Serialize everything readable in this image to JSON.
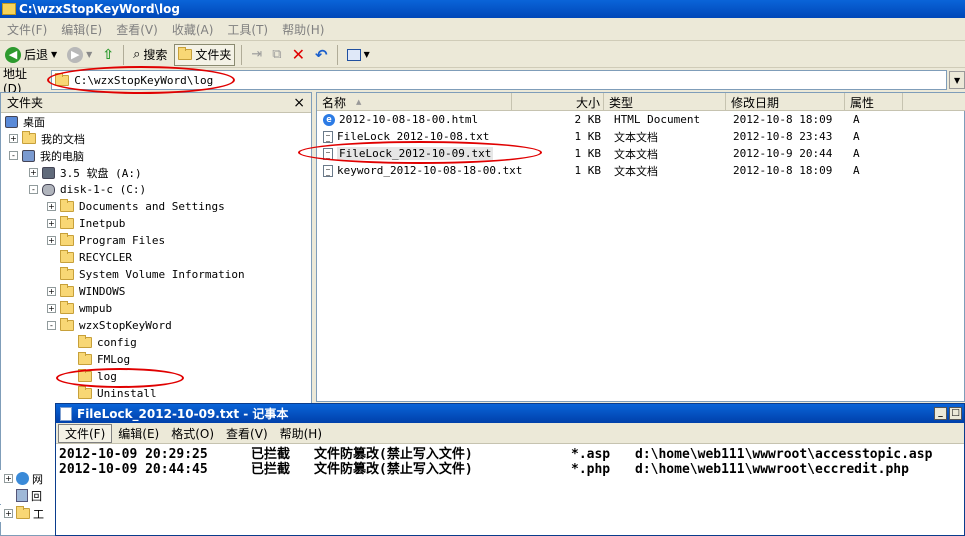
{
  "window": {
    "title": "C:\\wzxStopKeyWord\\log"
  },
  "menubar": [
    {
      "label": "文件(F)"
    },
    {
      "label": "编辑(E)"
    },
    {
      "label": "查看(V)"
    },
    {
      "label": "收藏(A)"
    },
    {
      "label": "工具(T)"
    },
    {
      "label": "帮助(H)"
    }
  ],
  "toolbar": {
    "back_label": "后退",
    "search_label": "搜索",
    "folders_label": "文件夹"
  },
  "address": {
    "label": "地址(D)",
    "value": "C:\\wzxStopKeyWord\\log"
  },
  "folder_pane": {
    "title": "文件夹",
    "close_glyph": "×",
    "tree": [
      {
        "label": "桌面",
        "exp": "none"
      },
      {
        "label": "我的文档",
        "exp": "+"
      },
      {
        "label": "我的电脑",
        "exp": "-"
      },
      {
        "label": "3.5 软盘 (A:)",
        "exp": "+"
      },
      {
        "label": "disk-1-c (C:)",
        "exp": "-"
      },
      {
        "label": "Documents and Settings",
        "exp": "+"
      },
      {
        "label": "Inetpub",
        "exp": "+"
      },
      {
        "label": "Program Files",
        "exp": "+"
      },
      {
        "label": "RECYCLER",
        "exp": "none"
      },
      {
        "label": "System Volume Information",
        "exp": "none"
      },
      {
        "label": "WINDOWS",
        "exp": "+"
      },
      {
        "label": "wmpub",
        "exp": "+"
      },
      {
        "label": "wzxStopKeyWord",
        "exp": "-"
      },
      {
        "label": "config",
        "exp": "none"
      },
      {
        "label": "FMLog",
        "exp": "none"
      },
      {
        "label": "log",
        "exp": "none"
      },
      {
        "label": "Uninstall",
        "exp": "none"
      }
    ],
    "bottom_strip": [
      {
        "label": "网"
      },
      {
        "label": "回"
      },
      {
        "label": "工"
      }
    ]
  },
  "file_list": {
    "columns": [
      "名称",
      "大小",
      "类型",
      "修改日期",
      "属性"
    ],
    "sort_glyph": "▲",
    "rows": [
      {
        "name": "2012-10-08-18-00.html",
        "size": "2 KB",
        "type": "HTML Document",
        "modified": "2012-10-8 18:09",
        "attr": "A",
        "icon": "ie-icon"
      },
      {
        "name": "FileLock_2012-10-08.txt",
        "size": "1 KB",
        "type": "文本文档",
        "modified": "2012-10-8 23:43",
        "attr": "A",
        "icon": "text-file-icon"
      },
      {
        "name": "FileLock_2012-10-09.txt",
        "size": "1 KB",
        "type": "文本文档",
        "modified": "2012-10-9 20:44",
        "attr": "A",
        "icon": "text-file-icon"
      },
      {
        "name": "keyword_2012-10-08-18-00.txt",
        "size": "1 KB",
        "type": "文本文档",
        "modified": "2012-10-8 18:09",
        "attr": "A",
        "icon": "text-file-icon"
      }
    ]
  },
  "notepad": {
    "title": "FileLock_2012-10-09.txt - 记事本",
    "menus": [
      {
        "label": "文件(F)"
      },
      {
        "label": "编辑(E)"
      },
      {
        "label": "格式(O)"
      },
      {
        "label": "查看(V)"
      },
      {
        "label": "帮助(H)"
      }
    ],
    "lines": [
      {
        "time": "2012-10-09 20:29:25",
        "action": "已拦截",
        "desc": "文件防篡改(禁止写入文件)",
        "ext": "*.asp",
        "path": "d:\\home\\web111\\wwwroot\\accesstopic.asp"
      },
      {
        "time": "2012-10-09 20:44:45",
        "action": "已拦截",
        "desc": "文件防篡改(禁止写入文件)",
        "ext": "*.php",
        "path": "d:\\home\\web111\\wwwroot\\eccredit.php"
      }
    ],
    "controls": {
      "minimize": "_",
      "maximize": "□"
    }
  },
  "colors": {
    "annotation": "#e00000",
    "titlebar": "#0a64d8"
  }
}
